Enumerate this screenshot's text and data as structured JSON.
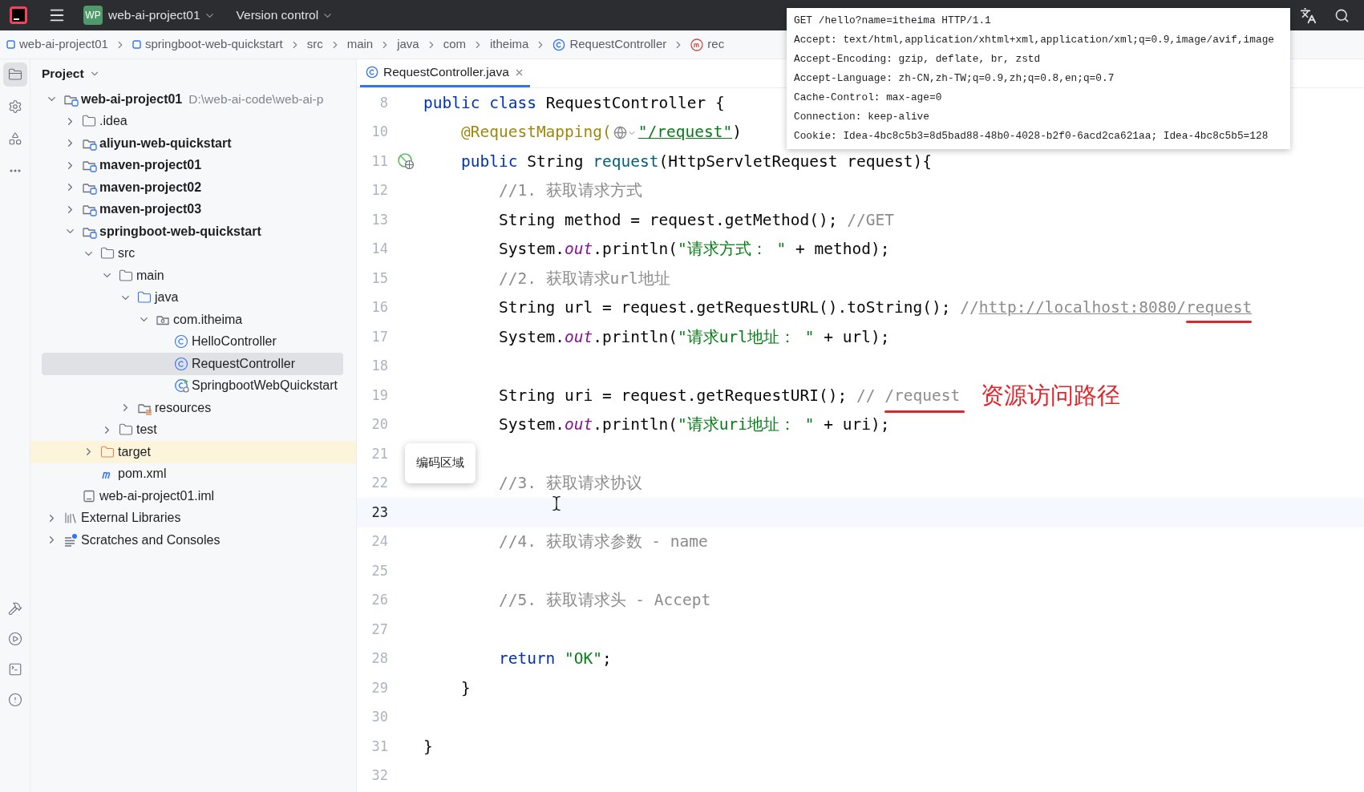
{
  "title_bar": {
    "project_badge": "WP",
    "project": "web-ai-project01",
    "vcs": "Version control"
  },
  "breadcrumbs": [
    {
      "label": "web-ai-project01",
      "kind": "module"
    },
    {
      "label": "springboot-web-quickstart",
      "kind": "module"
    },
    {
      "label": "src",
      "kind": "plain"
    },
    {
      "label": "main",
      "kind": "plain"
    },
    {
      "label": "java",
      "kind": "plain"
    },
    {
      "label": "com",
      "kind": "plain"
    },
    {
      "label": "itheima",
      "kind": "plain"
    },
    {
      "label": "RequestController",
      "kind": "class"
    },
    {
      "label": "rec",
      "kind": "method"
    }
  ],
  "tool_strip": {
    "top": [
      {
        "kind": "project",
        "selected": true
      },
      {
        "kind": "services",
        "selected": false
      },
      {
        "kind": "structure",
        "selected": false
      },
      {
        "kind": "more",
        "selected": false
      }
    ],
    "bottom": [
      {
        "kind": "build",
        "selected": false
      },
      {
        "kind": "run",
        "selected": false
      },
      {
        "kind": "terminal",
        "selected": false
      },
      {
        "kind": "problems",
        "selected": false
      }
    ]
  },
  "project": {
    "title": "Project",
    "tree": [
      {
        "label": "web-ai-project01",
        "kind": "module",
        "hint": "D:\\web-ai-code\\web-ai-p",
        "expanded": true,
        "selected": false,
        "children": [
          {
            "label": ".idea",
            "kind": "folder",
            "expanded": false,
            "selected": false
          },
          {
            "label": "aliyun-web-quickstart",
            "kind": "module",
            "expanded": false,
            "selected": false
          },
          {
            "label": "maven-project01",
            "kind": "module",
            "expanded": false,
            "selected": false
          },
          {
            "label": "maven-project02",
            "kind": "module",
            "expanded": false,
            "selected": false
          },
          {
            "label": "maven-project03",
            "kind": "module",
            "expanded": false,
            "selected": false
          },
          {
            "label": "springboot-web-quickstart",
            "kind": "module",
            "expanded": true,
            "selected": false,
            "children": [
              {
                "label": "src",
                "kind": "folder",
                "expanded": true,
                "selected": false,
                "children": [
                  {
                    "label": "main",
                    "kind": "folder",
                    "expanded": true,
                    "selected": false,
                    "children": [
                      {
                        "label": "java",
                        "kind": "source-folder",
                        "expanded": true,
                        "selected": false,
                        "children": [
                          {
                            "label": "com.itheima",
                            "kind": "package",
                            "expanded": true,
                            "selected": false,
                            "children": [
                              {
                                "label": "HelloController",
                                "kind": "class",
                                "selected": false
                              },
                              {
                                "label": "RequestController",
                                "kind": "class",
                                "selected": true
                              },
                              {
                                "label": "SpringbootWebQuickstart",
                                "kind": "spring-class",
                                "selected": false
                              }
                            ]
                          }
                        ]
                      },
                      {
                        "label": "resources",
                        "kind": "resources",
                        "expanded": false,
                        "selected": false
                      }
                    ]
                  },
                  {
                    "label": "test",
                    "kind": "folder",
                    "expanded": false,
                    "selected": false
                  }
                ]
              },
              {
                "label": "target",
                "kind": "excluded-folder",
                "expanded": false,
                "selected": false
              },
              {
                "label": "pom.xml",
                "kind": "maven",
                "selected": false
              }
            ]
          },
          {
            "label": "web-ai-project01.iml",
            "kind": "file",
            "selected": false
          }
        ]
      },
      {
        "label": "External Libraries",
        "kind": "libraries",
        "expanded": false,
        "selected": false
      },
      {
        "label": "Scratches and Consoles",
        "kind": "scratches",
        "expanded": false,
        "selected": false
      }
    ]
  },
  "editor": {
    "tabs": [
      {
        "label": "RequestController.java",
        "selected": true
      }
    ],
    "lines": [
      {
        "number": "8",
        "current": false,
        "tokens": [
          {
            "kind": "kw",
            "text": "public class "
          },
          {
            "kind": "plain",
            "text": "RequestController {"
          }
        ]
      },
      {
        "number": "10",
        "current": false,
        "tokens": [
          {
            "kind": "annotation",
            "text": "    @RequestMapping("
          },
          {
            "kind": "inlay"
          },
          {
            "kind": "path",
            "text": "\"/request\""
          },
          {
            "kind": "plain",
            "text": ")"
          }
        ]
      },
      {
        "number": "11",
        "current": false,
        "marker": true,
        "tokens": [
          {
            "kind": "kw",
            "text": "    public "
          },
          {
            "kind": "plain",
            "text": "String "
          },
          {
            "kind": "method",
            "text": "request"
          },
          {
            "kind": "plain",
            "text": "(HttpServletRequest request){"
          }
        ]
      },
      {
        "number": "12",
        "current": false,
        "tokens": [
          {
            "kind": "comment",
            "text": "        //1. 获取请求方式"
          }
        ]
      },
      {
        "number": "13",
        "current": false,
        "tokens": [
          {
            "kind": "plain",
            "text": "        String method = request.getMethod(); "
          },
          {
            "kind": "comment",
            "text": "//GET"
          }
        ]
      },
      {
        "number": "14",
        "current": false,
        "tokens": [
          {
            "kind": "plain",
            "text": "        System."
          },
          {
            "kind": "field",
            "text": "out"
          },
          {
            "kind": "plain",
            "text": ".println("
          },
          {
            "kind": "str",
            "text": "\"请求方式： \""
          },
          {
            "kind": "plain",
            "text": " + method);"
          }
        ]
      },
      {
        "number": "15",
        "current": false,
        "tokens": [
          {
            "kind": "comment",
            "text": "        //2. 获取请求url地址"
          }
        ]
      },
      {
        "number": "16",
        "current": false,
        "tokens": [
          {
            "kind": "plain",
            "text": "        String url = request.getRequestURL().toString(); "
          },
          {
            "kind": "comment",
            "text": "//"
          },
          {
            "kind": "marked-link",
            "text": "http://localhost:8080/request"
          }
        ]
      },
      {
        "number": "17",
        "current": false,
        "tokens": [
          {
            "kind": "plain",
            "text": "        System."
          },
          {
            "kind": "field",
            "text": "out"
          },
          {
            "kind": "plain",
            "text": ".println("
          },
          {
            "kind": "str",
            "text": "\"请求url地址： \""
          },
          {
            "kind": "plain",
            "text": " + url);"
          }
        ]
      },
      {
        "number": "18",
        "current": false
      },
      {
        "number": "19",
        "current": false,
        "tokens": [
          {
            "kind": "plain",
            "text": "        String uri = request.getRequestURI(); "
          },
          {
            "kind": "comment",
            "text": "// "
          },
          {
            "kind": "marked-comment",
            "text": "/request"
          },
          {
            "kind": "note",
            "text": "资源访问路径"
          }
        ]
      },
      {
        "number": "20",
        "current": false,
        "tokens": [
          {
            "kind": "plain",
            "text": "        System."
          },
          {
            "kind": "field",
            "text": "out"
          },
          {
            "kind": "plain",
            "text": ".println("
          },
          {
            "kind": "str",
            "text": "\"请求uri地址： \""
          },
          {
            "kind": "plain",
            "text": " + uri);"
          }
        ]
      },
      {
        "number": "21",
        "current": false
      },
      {
        "number": "22",
        "current": false,
        "tokens": [
          {
            "kind": "comment",
            "text": "        //3. 获取请求协议"
          }
        ]
      },
      {
        "number": "23",
        "current": true
      },
      {
        "number": "24",
        "current": false,
        "tokens": [
          {
            "kind": "comment",
            "text": "        //4. 获取请求参数 - name"
          }
        ]
      },
      {
        "number": "25",
        "current": false
      },
      {
        "number": "26",
        "current": false,
        "tokens": [
          {
            "kind": "comment",
            "text": "        //5. 获取请求头 - Accept"
          }
        ]
      },
      {
        "number": "27",
        "current": false
      },
      {
        "number": "28",
        "current": false,
        "tokens": [
          {
            "kind": "kw",
            "text": "        return "
          },
          {
            "kind": "str",
            "text": "\"OK\""
          },
          {
            "kind": "plain",
            "text": ";"
          }
        ]
      },
      {
        "number": "29",
        "current": false,
        "tokens": [
          {
            "kind": "plain",
            "text": "    }"
          }
        ]
      },
      {
        "number": "30",
        "current": false
      },
      {
        "number": "31",
        "current": false,
        "tokens": [
          {
            "kind": "plain",
            "text": "}"
          }
        ]
      },
      {
        "number": "32",
        "current": false
      }
    ]
  },
  "tooltip": "编码区域",
  "request_popup": {
    "lines": [
      "GET /hello?name=itheima HTTP/1.1",
      "Accept: text/html,application/xhtml+xml,application/xml;q=0.9,image/avif,image",
      "Accept-Encoding: gzip, deflate, br, zstd",
      "Accept-Language: zh-CN,zh-TW;q=0.9,zh;q=0.8,en;q=0.7",
      "Cache-Control: max-age=0",
      "Connection: keep-alive",
      "Cookie: Idea-4bc8c5b3=8d5bad88-48b0-4028-b2f0-6acd2ca621aa; Idea-4bc8c5b5=128"
    ]
  }
}
